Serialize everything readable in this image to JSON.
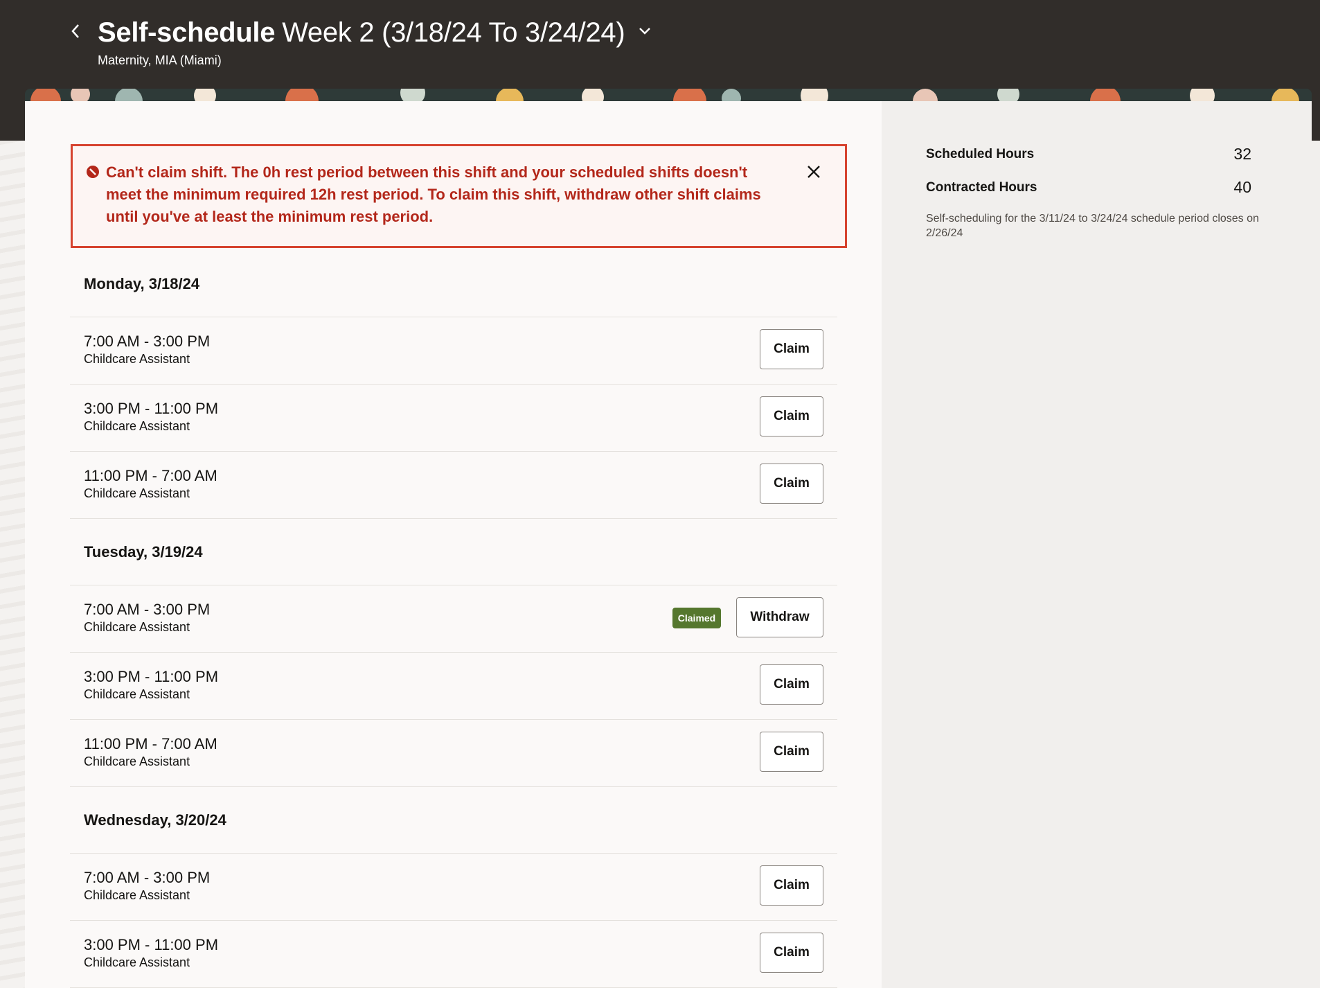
{
  "header": {
    "title_strong": "Self-schedule",
    "title_rest": "Week 2 (3/18/24 To 3/24/24)",
    "subtitle": "Maternity, MIA (Miami)"
  },
  "error": {
    "message": "Can't claim shift. The 0h rest period between this shift and your scheduled shifts doesn't meet the minimum required 12h rest period. To claim this shift, withdraw other shift claims until you've at least the minimum rest period."
  },
  "days": [
    {
      "label": "Monday, 3/18/24",
      "shifts": [
        {
          "time": "7:00 AM - 3:00 PM",
          "role": "Childcare Assistant",
          "action": "Claim"
        },
        {
          "time": "3:00 PM - 11:00 PM",
          "role": "Childcare Assistant",
          "action": "Claim"
        },
        {
          "time": "11:00 PM - 7:00 AM",
          "role": "Childcare Assistant",
          "action": "Claim"
        }
      ]
    },
    {
      "label": "Tuesday, 3/19/24",
      "shifts": [
        {
          "time": "7:00 AM - 3:00 PM",
          "role": "Childcare Assistant",
          "action": "Withdraw",
          "badge": "Claimed"
        },
        {
          "time": "3:00 PM - 11:00 PM",
          "role": "Childcare Assistant",
          "action": "Claim"
        },
        {
          "time": "11:00 PM - 7:00 AM",
          "role": "Childcare Assistant",
          "action": "Claim"
        }
      ]
    },
    {
      "label": "Wednesday, 3/20/24",
      "shifts": [
        {
          "time": "7:00 AM - 3:00 PM",
          "role": "Childcare Assistant",
          "action": "Claim"
        },
        {
          "time": "3:00 PM - 11:00 PM",
          "role": "Childcare Assistant",
          "action": "Claim"
        }
      ]
    }
  ],
  "summary": {
    "scheduled_label": "Scheduled Hours",
    "scheduled_value": "32",
    "contracted_label": "Contracted Hours",
    "contracted_value": "40",
    "note": "Self-scheduling for the 3/11/24 to 3/24/24 schedule period closes on 2/26/24"
  },
  "colors": {
    "header_bg": "#312d2a",
    "error": "#b3271a",
    "claimed_badge": "#55772e"
  },
  "icons": {
    "back": "chevron-left-icon",
    "title_menu": "chevron-down-icon",
    "error": "error-circle-icon",
    "close": "close-icon"
  }
}
